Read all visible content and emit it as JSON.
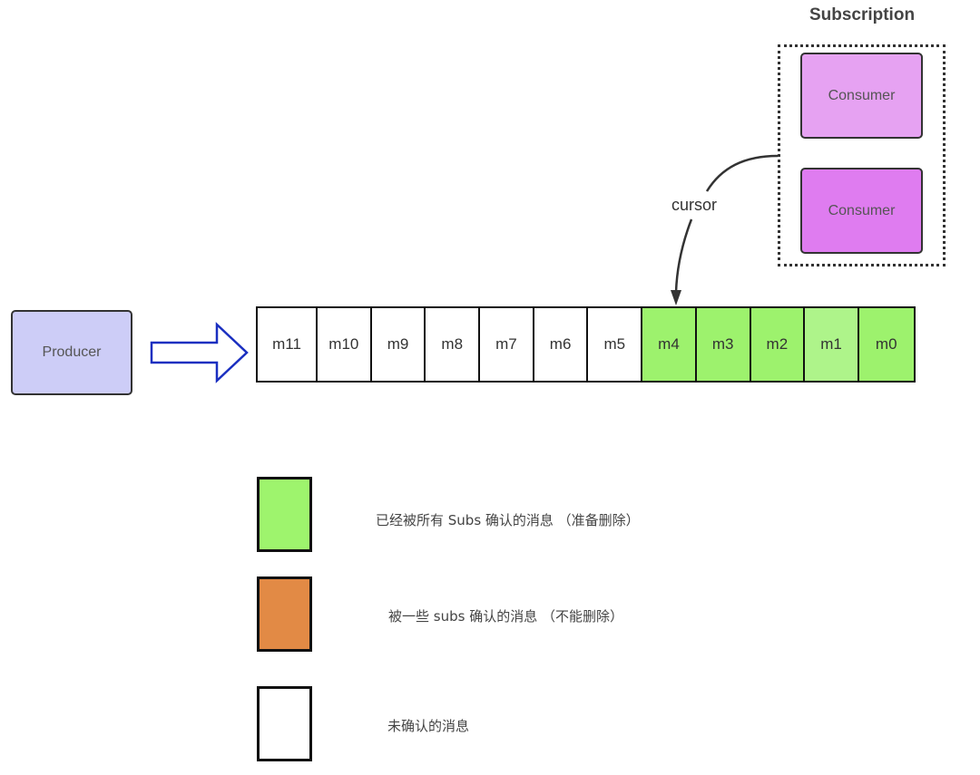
{
  "subscription": {
    "title": "Subscription",
    "consumers": [
      {
        "label": "Consumer",
        "color": "#e6a2f2"
      },
      {
        "label": "Consumer",
        "color": "#df7cf0"
      }
    ]
  },
  "producer": {
    "label": "Producer",
    "color": "#cdcdf7"
  },
  "cursor": {
    "label": "cursor",
    "points_to": "m4"
  },
  "queue": {
    "cells": [
      {
        "label": "m11",
        "state": "unacked",
        "color": "#ffffff"
      },
      {
        "label": "m10",
        "state": "unacked",
        "color": "#ffffff"
      },
      {
        "label": "m9",
        "state": "unacked",
        "color": "#ffffff"
      },
      {
        "label": "m8",
        "state": "unacked",
        "color": "#ffffff"
      },
      {
        "label": "m7",
        "state": "unacked",
        "color": "#ffffff"
      },
      {
        "label": "m6",
        "state": "unacked",
        "color": "#ffffff"
      },
      {
        "label": "m5",
        "state": "unacked",
        "color": "#ffffff"
      },
      {
        "label": "m4",
        "state": "acked_all",
        "color": "#9df26d"
      },
      {
        "label": "m3",
        "state": "acked_all",
        "color": "#9df26d"
      },
      {
        "label": "m2",
        "state": "acked_all",
        "color": "#9df26d"
      },
      {
        "label": "m1",
        "state": "acked_all",
        "color": "#aef48a"
      },
      {
        "label": "m0",
        "state": "acked_all",
        "color": "#9df26d"
      }
    ]
  },
  "legend": [
    {
      "color": "#9ef46d",
      "text": "已经被所有 Subs 确认的消息 （准备删除）"
    },
    {
      "color": "#e28a45",
      "text": "被一些 subs 确认的消息 （不能删除）"
    },
    {
      "color": "#ffffff",
      "text": "未确认的消息"
    }
  ],
  "colors": {
    "arrow_outline": "#1a2fc0",
    "line": "#333333"
  }
}
